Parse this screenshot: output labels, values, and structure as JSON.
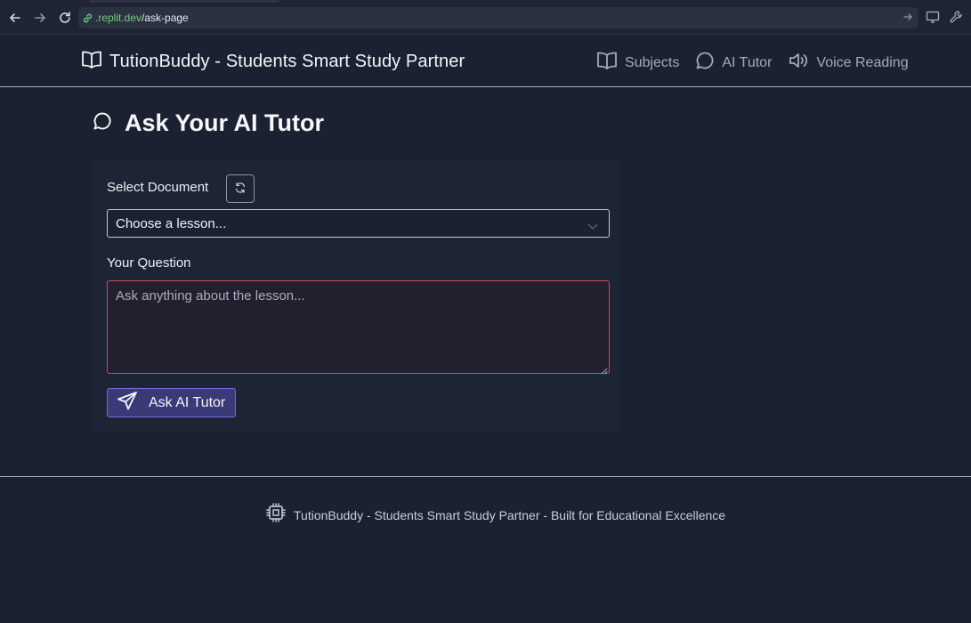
{
  "browser": {
    "url_domain": ".replit.dev",
    "url_path": "/ask-page"
  },
  "header": {
    "brand_title": "TutionBuddy - Students Smart Study Partner",
    "nav": [
      {
        "label": "Subjects",
        "icon": "book-open-icon"
      },
      {
        "label": "AI Tutor",
        "icon": "chat-bubble-icon"
      },
      {
        "label": "Voice Reading",
        "icon": "speaker-icon"
      }
    ]
  },
  "main": {
    "title": "Ask Your AI Tutor",
    "title_icon": "chat-bubble-icon",
    "form": {
      "document_label": "Select Document",
      "document_selected": "Choose a lesson...",
      "question_label": "Your Question",
      "question_placeholder": "Ask anything about the lesson...",
      "question_value": "",
      "submit_label": "Ask AI Tutor"
    }
  },
  "footer": {
    "text": "TutionBuddy - Students Smart Study Partner - Built for Educational Excellence",
    "icon": "chip-icon"
  },
  "colors": {
    "background": "#1b2130",
    "accent": "#3b3a78",
    "accent_border": "#6f6ee0",
    "error_border": "#d8484e",
    "url_domain": "#6fcf7f"
  }
}
